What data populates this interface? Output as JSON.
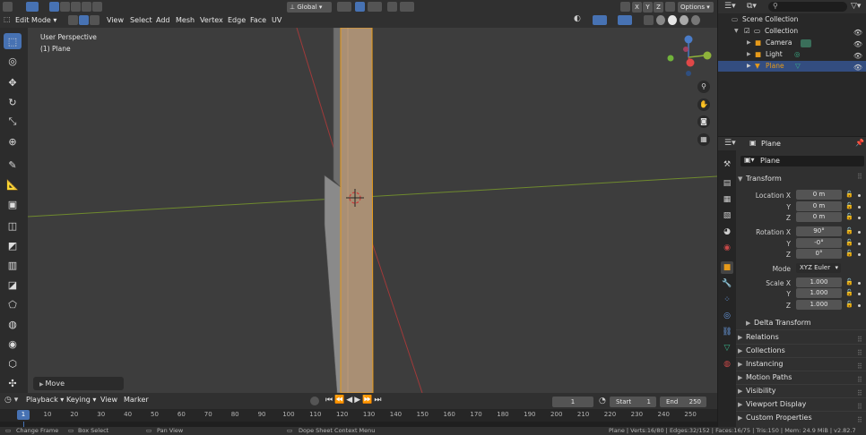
{
  "top": {
    "transform_orientation": "Global",
    "options": "Options",
    "axes": [
      "X",
      "Y",
      "Z"
    ]
  },
  "viewport_header": {
    "mode": "Edit Mode",
    "menus": [
      "View",
      "Select",
      "Add",
      "Mesh",
      "Vertex",
      "Edge",
      "Face",
      "UV"
    ]
  },
  "viewport": {
    "perspective": "User Perspective",
    "object": "(1) Plane",
    "last_operator": "Move"
  },
  "toolbar_icons": [
    "select-box-icon",
    "cursor-icon",
    "move-icon",
    "rotate-icon",
    "scale-icon",
    "transform-icon",
    "annotate-icon",
    "measure-icon",
    "extrude-icon",
    "inset-icon",
    "bevel-icon",
    "loop-cut-icon",
    "knife-icon",
    "poly-build-icon",
    "spin-icon",
    "smooth-icon",
    "shrink-fatten-icon",
    "shear-icon"
  ],
  "timeline": {
    "menus": [
      "Playback",
      "Keying",
      "View",
      "Marker"
    ],
    "current_frame": "1",
    "start_label": "Start",
    "start": "1",
    "end_label": "End",
    "end": "250",
    "ruler_current": "1",
    "ticks": [
      "10",
      "20",
      "30",
      "40",
      "50",
      "60",
      "70",
      "80",
      "90",
      "100",
      "110",
      "120",
      "130",
      "140",
      "150",
      "160",
      "170",
      "180",
      "190",
      "200",
      "210",
      "220",
      "230",
      "240",
      "250"
    ]
  },
  "statusbar": {
    "change_frame": "Change Frame",
    "box_select": "Box Select",
    "pan_view": "Pan View",
    "context_menu": "Dope Sheet Context Menu",
    "stats": "Plane | Verts:16/80 | Edges:32/152 | Faces:16/75 | Tris:150 | Mem: 24.9 MiB | v2.82.7"
  },
  "outliner": {
    "scene_collection": "Scene Collection",
    "collection": "Collection",
    "items": [
      "Camera",
      "Light",
      "Plane"
    ]
  },
  "properties": {
    "header_object": "Plane",
    "object_name": "Plane",
    "transform_title": "Transform",
    "location_label": "Location X",
    "rotation_label": "Rotation X",
    "scale_label": "Scale X",
    "y_label": "Y",
    "z_label": "Z",
    "location": [
      "0 m",
      "0 m",
      "0 m"
    ],
    "rotation": [
      "90°",
      "-0°",
      "0°"
    ],
    "mode_label": "Mode",
    "mode_value": "XYZ Euler",
    "scale": [
      "1.000",
      "1.000",
      "1.000"
    ],
    "sections": [
      "Delta Transform",
      "Relations",
      "Collections",
      "Instancing",
      "Motion Paths",
      "Visibility",
      "Viewport Display",
      "Custom Properties"
    ]
  },
  "colors": {
    "accent": "#4772b3",
    "selection": "#334d80",
    "object_outline": "#e69a1a",
    "axis_x": "#c84848",
    "axis_y": "#8fb33b"
  }
}
